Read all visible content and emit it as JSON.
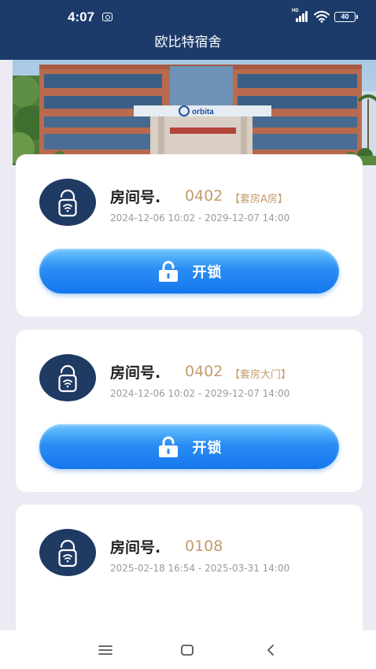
{
  "status_bar": {
    "time": "4:07",
    "network_badge": "HD",
    "battery_level": "40"
  },
  "header": {
    "title": "欧比特宿舍"
  },
  "banner": {
    "building_sign": "orbita"
  },
  "rooms": [
    {
      "label": "房间号.",
      "number": "0402",
      "type": "【套房A房】",
      "validity": "2024-12-06 10:02 - 2029-12-07 14:00",
      "unlock_label": "开锁"
    },
    {
      "label": "房间号.",
      "number": "0402",
      "type": "【套房大门】",
      "validity": "2024-12-06 10:02 - 2029-12-07 14:00",
      "unlock_label": "开锁"
    },
    {
      "label": "房间号.",
      "number": "0108",
      "type": "",
      "validity": "2025-02-18 16:54 - 2025-03-31 14:00"
    }
  ],
  "nav": {
    "icons": [
      "menu-icon",
      "home-icon",
      "back-icon"
    ]
  },
  "colors": {
    "header_bg": "#1c3b6b",
    "accent_blue": "#1677ee",
    "room_number": "#c49a6c",
    "page_bg": "#ecebf3",
    "avatar_bg": "#1f3a63"
  }
}
